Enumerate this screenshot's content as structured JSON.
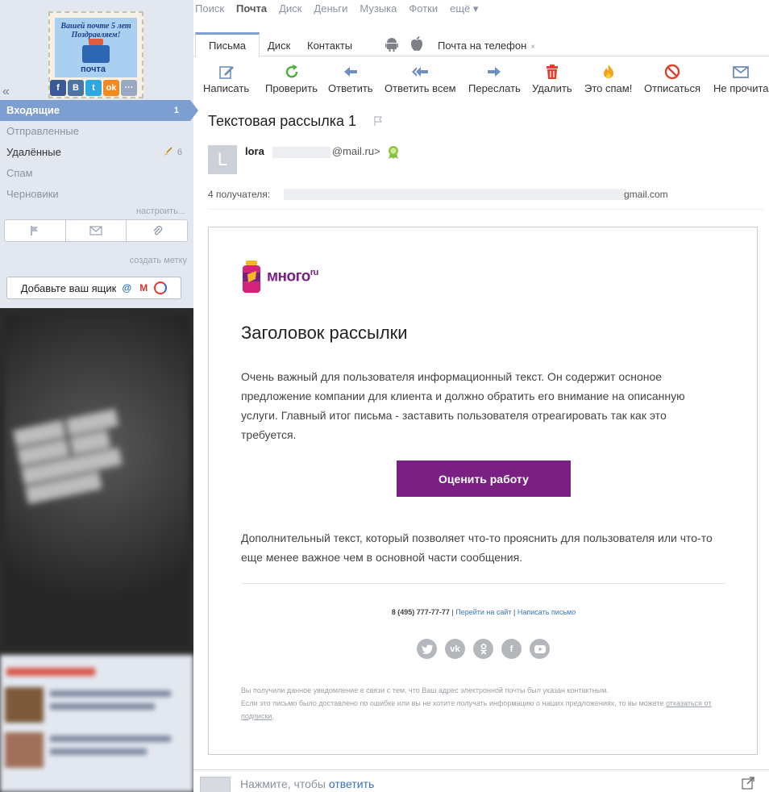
{
  "logo": {
    "greeting": "Вашей почте 5 лет Поздравляем!",
    "mail_word": "почта"
  },
  "social_icons": [
    "facebook-icon",
    "vk-icon",
    "twitter-icon",
    "odnoklassniki-icon",
    "more-icon"
  ],
  "top_nav": [
    "Поиск",
    "Почта",
    "Диск",
    "Деньги",
    "Музыка",
    "Фотки",
    "ещё ▾"
  ],
  "tabs": {
    "letters": "Письма",
    "disk": "Диск",
    "contacts": "Контакты",
    "phone": "Почта на телефон",
    "close": "×"
  },
  "toolbar": {
    "compose": "Написать",
    "check": "Проверить",
    "reply": "Ответить",
    "reply_all": "Ответить всем",
    "forward": "Переслать",
    "delete": "Удалить",
    "spam": "Это спам!",
    "unsubscribe": "Отписаться",
    "unread": "Не прочита"
  },
  "folders": [
    {
      "label": "Входящие",
      "count": "1"
    },
    {
      "label": "Отправленные",
      "count": ""
    },
    {
      "label": "Удалённые",
      "count": "6"
    },
    {
      "label": "Спам",
      "count": ""
    },
    {
      "label": "Черновики",
      "count": ""
    }
  ],
  "sidebar": {
    "configure": "настроить...",
    "create_label": "создать метку",
    "add_mailbox": "Добавьте ваш ящик"
  },
  "message": {
    "subject": "Текстовая рассылка 1",
    "avatar_letter": "L",
    "sender_name": "lora",
    "sender_domain": "@mail.ru>",
    "recipients_label": "4 получателя:",
    "recipients_tail": "gmail.com"
  },
  "letter": {
    "brand": "много",
    "brand_sup": "ru",
    "title": "Заголовок рассылки",
    "body": "Очень важный для пользователя информационный текст. Он содержит осноное предложение компании для клиента и должно обратить его внимание на описанную услуги. Главный итог письма - заставить пользователя отреагировать так как это требуется.",
    "button": "Оценить работу",
    "extra": "Дополнительный текст, который позволяет что-то прояснить для пользователя или что-то еще менее важное чем в основной части сообщения.",
    "phone": "8 (495) 777-77-77",
    "sep": "|",
    "link_site": "Перейти на сайт",
    "link_write": "Написать письмо",
    "social": [
      "twitter-icon",
      "vk-icon",
      "odnoklassniki-icon",
      "facebook-icon",
      "youtube-icon"
    ],
    "disclaimer_1": "Вы получили данное уведомление в связи с тем, что Ваш адрес электронной почты был указан контактным.",
    "disclaimer_2": "Если это письмо было доставлено по ошибке или вы не хотите получать информацию о наших предложениях, то вы можете",
    "unsubscribe_link": "отказаться от подписки",
    "period": "."
  },
  "reply": {
    "prompt": "Нажмите, чтобы",
    "link": "ответить"
  },
  "colors": {
    "accent": "#7c9ed1",
    "brand_purple": "#7a2083",
    "sidebar_bg": "#e3e8f0"
  }
}
